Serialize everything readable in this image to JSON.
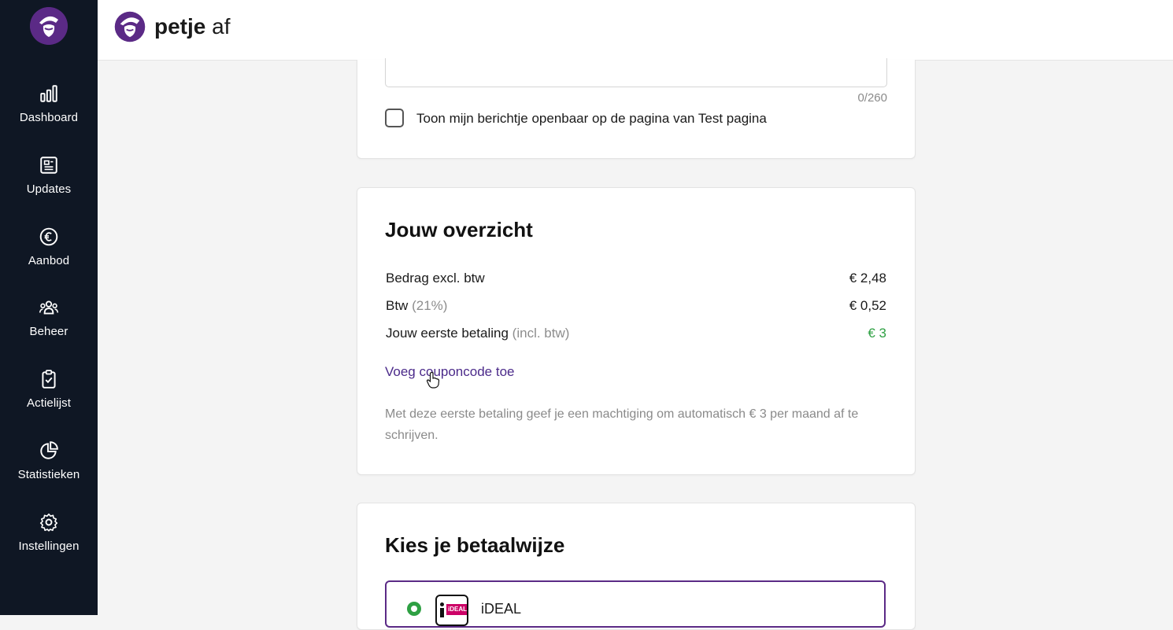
{
  "brand": {
    "name_bold": "petje",
    "name_light": "af"
  },
  "sidebar": {
    "items": [
      {
        "label": "Dashboard",
        "icon": "bar-chart-icon"
      },
      {
        "label": "Updates",
        "icon": "newspaper-icon"
      },
      {
        "label": "Aanbod",
        "icon": "euro-icon"
      },
      {
        "label": "Beheer",
        "icon": "users-icon"
      },
      {
        "label": "Actielijst",
        "icon": "clipboard-check-icon"
      },
      {
        "label": "Statistieken",
        "icon": "pie-chart-icon"
      },
      {
        "label": "Instellingen",
        "icon": "gear-icon"
      }
    ]
  },
  "message": {
    "counter": "0/260",
    "checkbox_label": "Toon mijn berichtje openbaar op de pagina van Test pagina",
    "checked": false
  },
  "overview": {
    "title": "Jouw overzicht",
    "rows": [
      {
        "label": "Bedrag excl. btw",
        "muted": "",
        "value": "€ 2,48"
      },
      {
        "label": "Btw",
        "muted": "(21%)",
        "value": "€ 0,52"
      },
      {
        "label": "Jouw eerste betaling",
        "muted": "(incl. btw)",
        "value": "€ 3"
      }
    ],
    "coupon_link": "Voeg couponcode toe",
    "note": "Met deze eerste betaling geef je een machtiging om automatisch € 3 per maand af te schrijven."
  },
  "payment": {
    "title": "Kies je betaalwijze",
    "option_label": "iDEAL",
    "logo_text": "iDEAL",
    "selected": true
  },
  "colors": {
    "sidebar_bg": "#0f1724",
    "brand_purple": "#5b2a86",
    "link_purple": "#4b2a8a",
    "success_green": "#2ea043"
  }
}
